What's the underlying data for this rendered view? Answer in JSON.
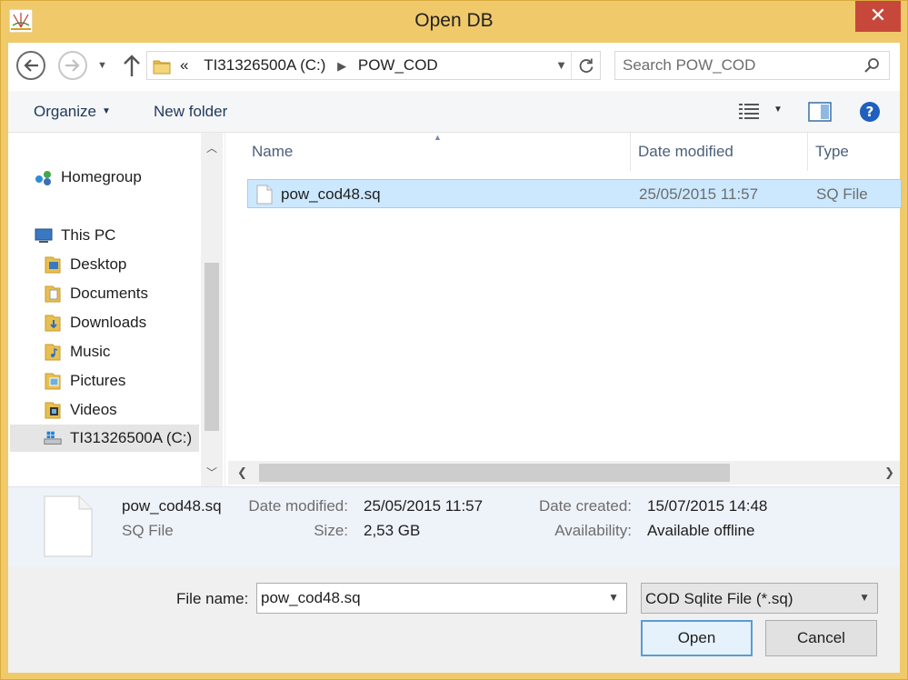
{
  "window": {
    "title": "Open DB",
    "close_glyph": "✕"
  },
  "address": {
    "overflow": "«",
    "crumbs": [
      "TI31326500A (C:)",
      "POW_COD"
    ],
    "separator": "▶"
  },
  "search": {
    "placeholder": "Search POW_COD",
    "value": ""
  },
  "toolbar": {
    "organize": "Organize",
    "new_folder": "New folder"
  },
  "nav": {
    "items": [
      {
        "label": "Homegroup",
        "icon": "homegroup-icon"
      },
      {
        "label": "This PC",
        "icon": "computer-icon"
      },
      {
        "label": "Desktop",
        "icon": "folder-icon"
      },
      {
        "label": "Documents",
        "icon": "folder-icon"
      },
      {
        "label": "Downloads",
        "icon": "folder-icon"
      },
      {
        "label": "Music",
        "icon": "folder-icon"
      },
      {
        "label": "Pictures",
        "icon": "folder-icon"
      },
      {
        "label": "Videos",
        "icon": "folder-icon"
      },
      {
        "label": "TI31326500A (C:)",
        "icon": "drive-icon",
        "selected": true
      }
    ]
  },
  "filelist": {
    "columns": {
      "name": "Name",
      "date": "Date modified",
      "type": "Type"
    },
    "rows": [
      {
        "name": "pow_cod48.sq",
        "date": "25/05/2015 11:57",
        "type": "SQ File",
        "selected": true
      }
    ]
  },
  "details": {
    "name": "pow_cod48.sq",
    "type": "SQ File",
    "date_modified_label": "Date modified:",
    "date_modified": "25/05/2015 11:57",
    "size_label": "Size:",
    "size": "2,53 GB",
    "date_created_label": "Date created:",
    "date_created": "15/07/2015 14:48",
    "availability_label": "Availability:",
    "availability": "Available offline"
  },
  "bottom": {
    "file_name_label": "File name:",
    "file_name_value": "pow_cod48.sq",
    "filter_value": "COD Sqlite File (*.sq)",
    "open_label": "Open",
    "cancel_label": "Cancel"
  },
  "colors": {
    "selection": "#cce8ff",
    "selection_border": "#99d1ff",
    "frame": "#f0c96a",
    "close": "#c7483a"
  }
}
